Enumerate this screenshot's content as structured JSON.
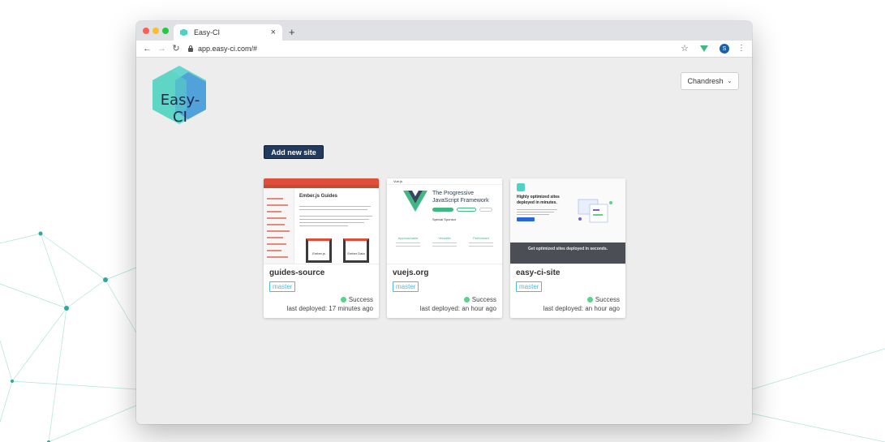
{
  "browser": {
    "tab_title": "Easy-CI",
    "tab_close": "×",
    "new_tab": "+",
    "url": "app.easy-ci.com/#",
    "profile_initial": "S",
    "menu_glyph": "⋮",
    "back_glyph": "←",
    "forward_glyph": "→",
    "reload_glyph": "↻",
    "star_glyph": "☆"
  },
  "header": {
    "logo_text": "Easy-CI",
    "user_name": "Chandresh",
    "chevron_glyph": "⌄"
  },
  "main": {
    "add_site_label": "Add new site"
  },
  "sites": [
    {
      "name": "guides-source",
      "branch": "master",
      "status": "Success",
      "deployed": "last deployed: 17 minutes ago",
      "thumb": {
        "title": "Ember.js Guides",
        "box1": "Ember.js",
        "box2": "Ember Data"
      }
    },
    {
      "name": "vuejs.org",
      "branch": "master",
      "status": "Success",
      "deployed": "last deployed: an hour ago",
      "thumb": {
        "brand": "Vue.js",
        "headline": "The Progressive JavaScript Framework",
        "sponsor": "Special Sponsor",
        "col1": "Approachable",
        "col2": "Versatile",
        "col3": "Performant"
      }
    },
    {
      "name": "easy-ci-site",
      "branch": "master",
      "status": "Success",
      "deployed": "last deployed: an hour ago",
      "thumb": {
        "headline": "Highly optimized sites deployed in minutes.",
        "tagline": "Get optimized sites deployed in seconds."
      }
    }
  ],
  "colors": {
    "button_bg": "#223a5e",
    "badge": "#52b8d8",
    "success": "#5ecf8c",
    "logo_teal": "#4fd1c5",
    "logo_blue": "#4a8fe0"
  }
}
